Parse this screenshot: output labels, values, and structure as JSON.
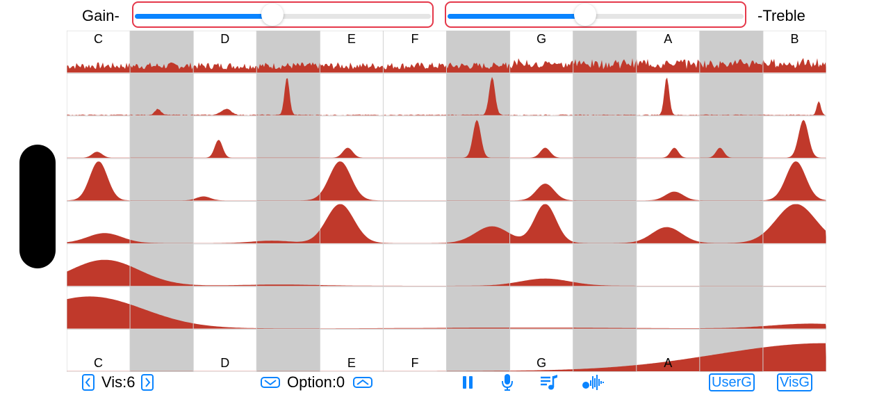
{
  "header": {
    "gain_label": "Gain-",
    "treble_label": "-Treble",
    "gain_slider_value": 0.46,
    "treble_slider_value": 0.46
  },
  "notes_top": [
    "C",
    "D",
    "E",
    "F",
    "G",
    "A",
    "B"
  ],
  "notes_bottom": [
    "C",
    "D",
    "E",
    "F",
    "G",
    "A"
  ],
  "colors": {
    "accent": "#0a84ff",
    "slider_border": "#e5384a",
    "spectrum": "#c0392b",
    "shaded_column": "#cccccc",
    "handle": "#000000"
  },
  "footer": {
    "prev_icon": "chevron-left-square-icon",
    "vis_label": "Vis:6",
    "next_icon": "chevron-right-square-icon",
    "option_down_icon": "chevron-down-rect-icon",
    "option_label": "Option:0",
    "option_up_icon": "chevron-up-rect-icon",
    "pause_icon": "pause-icon",
    "mic_icon": "microphone-icon",
    "playlist_icon": "music-list-icon",
    "waveform_icon": "waveform-icon",
    "userg_label": "UserG",
    "visg_label": "VisG"
  }
}
